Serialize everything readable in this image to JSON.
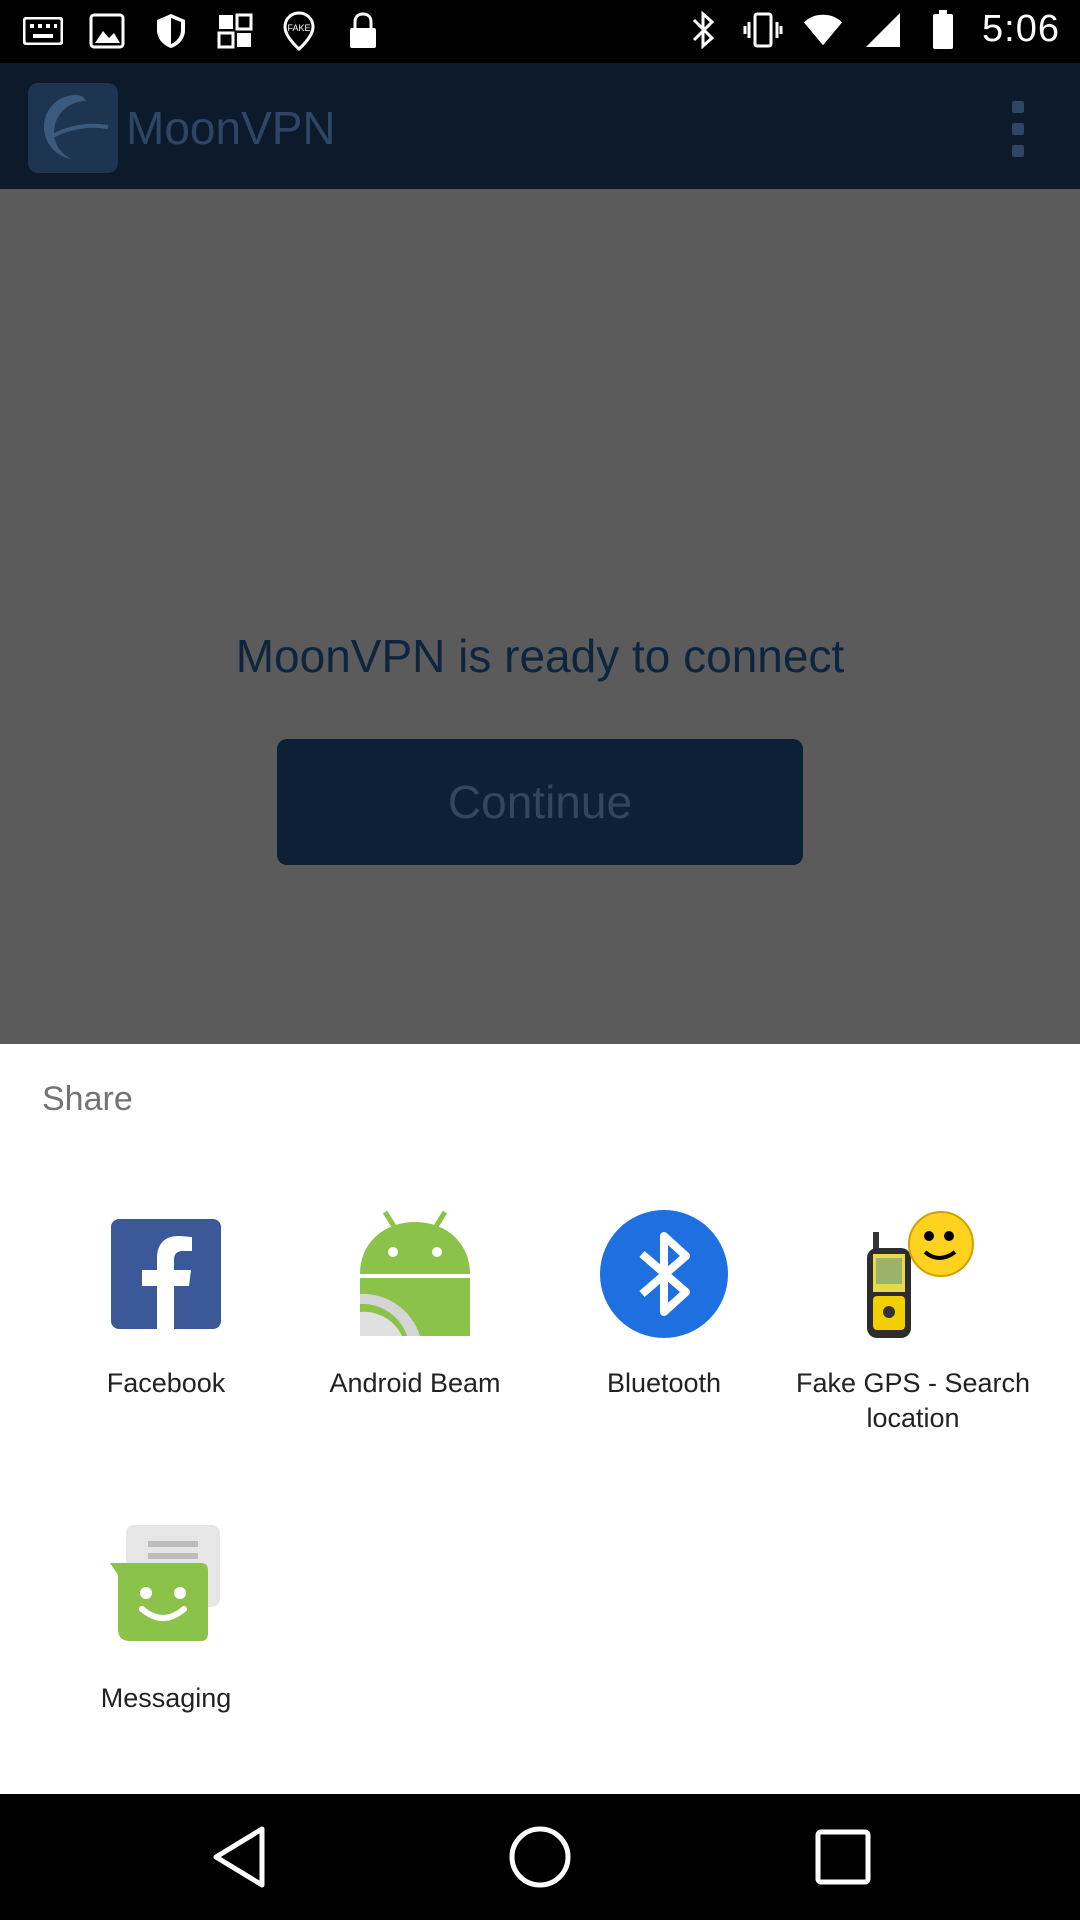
{
  "status_bar": {
    "time": "5:06",
    "icons_left": [
      "keyboard-icon",
      "image-icon",
      "shield-icon",
      "grid-icon",
      "location-icon",
      "lock-icon"
    ],
    "icons_right": [
      "bluetooth-icon",
      "vibrate-icon",
      "wifi-icon",
      "signal-icon",
      "battery-icon"
    ]
  },
  "app_bar": {
    "title": "MoonVPN",
    "logo_icon": "moon-logo-icon",
    "menu_icon": "more-vert-icon"
  },
  "main": {
    "message": "MoonVPN is ready to connect",
    "continue_label": "Continue"
  },
  "share_sheet": {
    "title": "Share",
    "targets": [
      {
        "label": "Facebook",
        "icon": "facebook-icon"
      },
      {
        "label": "Android Beam",
        "icon": "android-beam-icon"
      },
      {
        "label": "Bluetooth",
        "icon": "bluetooth-icon"
      },
      {
        "label": "Fake GPS - Search location",
        "icon": "fake-gps-icon"
      },
      {
        "label": "Messaging",
        "icon": "messaging-icon"
      }
    ]
  },
  "nav_bar": {
    "buttons": [
      "back-icon",
      "home-icon",
      "recents-icon"
    ]
  },
  "colors": {
    "app_bar": "#0c1a2c",
    "scrim": "#5b5b5b",
    "facebook": "#3b5998",
    "android_green": "#8bc34a",
    "bluetooth": "#1e6fe0",
    "messaging_green": "#8bc34a"
  }
}
